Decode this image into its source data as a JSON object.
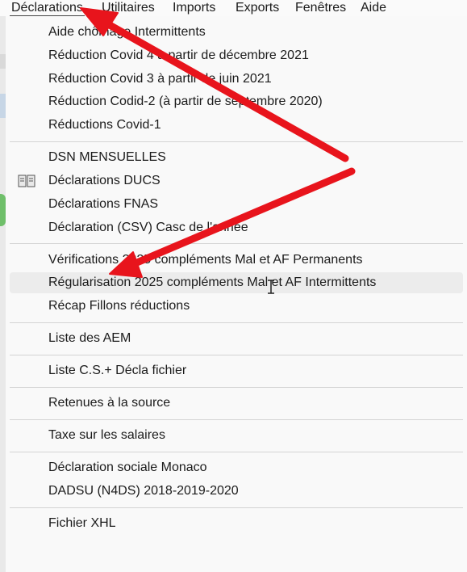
{
  "menubar": {
    "items": [
      "Déclarations",
      "Utilitaires",
      "Imports",
      "Exports",
      "Fenêtres",
      "Aide"
    ]
  },
  "menu": {
    "groups": [
      [
        "Aide chômage Intermittents",
        "Réduction Covid 4 à partir de décembre 2021",
        "Réduction Covid 3 à partir de juin 2021",
        "Réduction Codid-2 (à partir de septembre 2020)",
        "Réductions Covid-1"
      ],
      [
        "DSN MENSUELLES",
        "Déclarations DUCS",
        "Déclarations FNAS",
        "Déclaration (CSV) Casc de l'année"
      ],
      [
        "Vérifications 2025 compléments Mal et AF Permanents",
        "Régularisation 2025 compléments Mal et AF Intermittents",
        "Récap Fillons  réductions"
      ],
      [
        "Liste des AEM"
      ],
      [
        "Liste C.S.+ Décla fichier"
      ],
      [
        "Retenues à la source"
      ],
      [
        "Taxe sur les salaires"
      ],
      [
        "Déclaration sociale Monaco",
        "DADSU (N4DS) 2018-2019-2020"
      ],
      [
        "Fichier XHL"
      ]
    ]
  },
  "hover_item": "Régularisation 2025 compléments Mal et AF Intermittents",
  "icon_items": {
    "Déclarations DUCS": "book-icon"
  },
  "colors": {
    "annotation_arrow": "#e8141c",
    "hover_bg": "#ececec",
    "separator": "#d4d4d4"
  }
}
